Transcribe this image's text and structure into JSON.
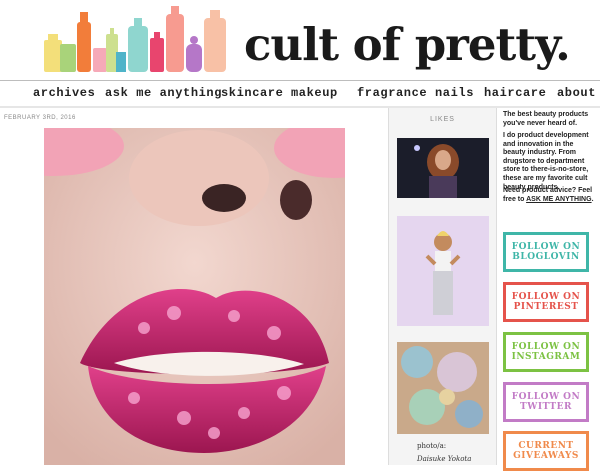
{
  "site": {
    "logo_text": "cult of pretty."
  },
  "nav": {
    "items": [
      {
        "label": "archives"
      },
      {
        "label": "ask me anything"
      },
      {
        "label": "skincare"
      },
      {
        "label": "makeup"
      },
      {
        "label": "fragrance"
      },
      {
        "label": "nails"
      },
      {
        "label": "haircare"
      },
      {
        "label": "about"
      }
    ]
  },
  "post": {
    "date": "FEBRUARY 3RD, 2016"
  },
  "likes": {
    "title": "LIKES",
    "credit_label": "photo/a:",
    "credit_name": "Daisuke Yokota"
  },
  "sidebar": {
    "tagline": "The best beauty products you've never heard of.",
    "intro": "I do product development and innovation in the beauty industry. From drugstore to department store to there-is-no-store, these are my favorite cult beauty products.",
    "advice_prefix": "Need product advice? Feel free to",
    "advice_link": "ASK ME ANYTHING",
    "advice_suffix": ".",
    "badges": [
      {
        "line1": "FOLLOW ON",
        "line2": "BLOGLOVIN",
        "color": "#3fb6a8"
      },
      {
        "line1": "FOLLOW ON",
        "line2": "PINTEREST",
        "color": "#e5534b"
      },
      {
        "line1": "FOLLOW ON",
        "line2": "INSTAGRAM",
        "color": "#7cc243"
      },
      {
        "line1": "FOLLOW ON",
        "line2": "TWITTER",
        "color": "#c27bc6"
      },
      {
        "line1": "CURRENT",
        "line2": "GIVEAWAYS",
        "color": "#f08a4b"
      }
    ]
  }
}
